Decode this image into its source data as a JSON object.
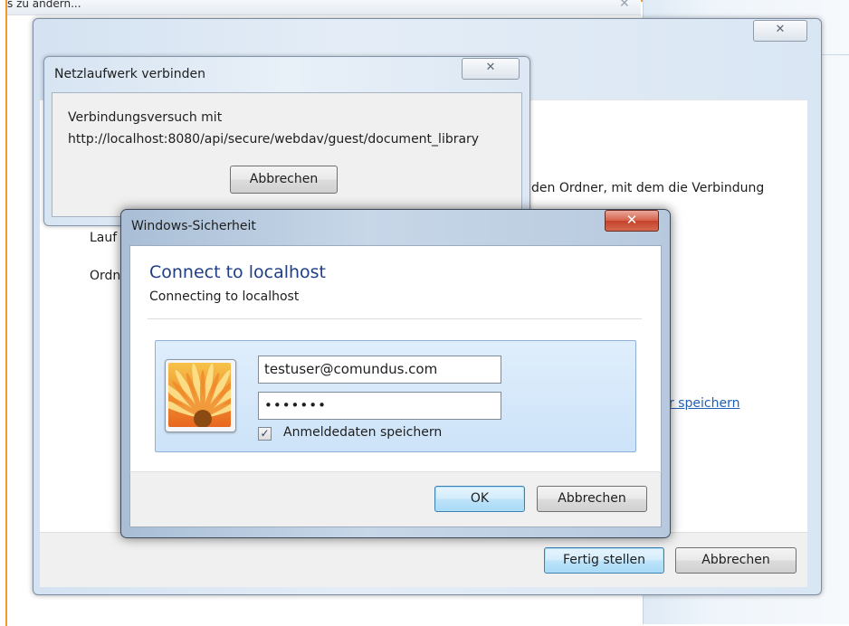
{
  "background_window": {
    "title_fragment": "s zu ändern...",
    "close_glyph": "✕"
  },
  "wizard": {
    "close_glyph": "✕",
    "description_fragment": "den Ordner, mit dem die Verbindung",
    "drive_label_fragment": "Lauf",
    "folder_label_fragment": "Ordn",
    "link_fragment": "r speichern",
    "finish_label": "Fertig stellen",
    "cancel_label": "Abbrechen"
  },
  "netz_dialog": {
    "title": "Netzlaufwerk verbinden",
    "close_glyph": "✕",
    "message_line1": "Verbindungsversuch mit",
    "message_line2": "http://localhost:8080/api/secure/webdav/guest/document_library",
    "cancel_label": "Abbrechen"
  },
  "security_dialog": {
    "title": "Windows-Sicherheit",
    "close_glyph": "✕",
    "heading": "Connect to localhost",
    "subheading": "Connecting to localhost",
    "username_value": "testuser@comundus.com",
    "password_value": "•••••••",
    "save_checkbox_checked": true,
    "save_checkbox_glyph": "✓",
    "save_label": "Anmeldedaten speichern",
    "ok_label": "OK",
    "cancel_label": "Abbrechen",
    "avatar_icon": "flower-user-tile-icon"
  },
  "colors": {
    "accent_orange": "#f39a2b",
    "heading_blue": "#1e3f86",
    "link_blue": "#1f5fb5",
    "close_red": "#c6422c"
  }
}
